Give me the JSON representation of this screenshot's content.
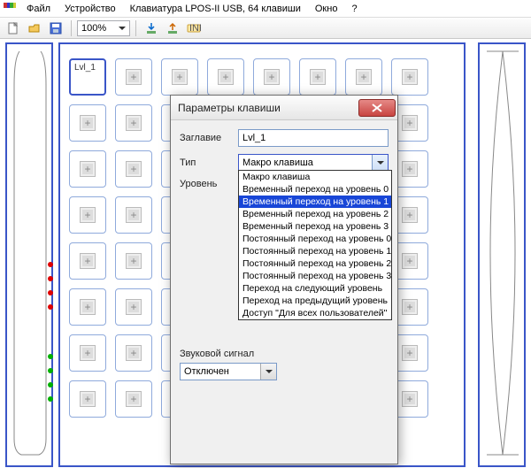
{
  "menu": {
    "items": [
      "Файл",
      "Устройство",
      "Клавиатура LPOS-II USB, 64 клавиши",
      "Окно",
      "?"
    ]
  },
  "toolbar": {
    "zoom": "100%"
  },
  "keys": {
    "selected_label": "Lvl_1"
  },
  "dialog": {
    "title": "Параметры клавиши",
    "labels": {
      "caption": "Заглавие",
      "type": "Тип",
      "level": "Уровень",
      "sound": "Звуковой сигнал"
    },
    "caption_value": "Lvl_1",
    "type_value": "Макро клавиша",
    "level_options": [
      "Макро клавиша",
      "Временный переход на уровень 0",
      "Временный переход на уровень 1",
      "Временный переход на уровень 2",
      "Временный переход на уровень 3",
      "Постоянный переход на уровень 0",
      "Постоянный переход на уровень 1",
      "Постоянный переход на уровень 2",
      "Постоянный переход на уровень 3",
      "Переход на следующий уровень",
      "Переход на предыдущий уровень",
      "Доступ \"Для всех пользователей\""
    ],
    "level_selected_index": 2,
    "sound_value": "Отключен"
  }
}
